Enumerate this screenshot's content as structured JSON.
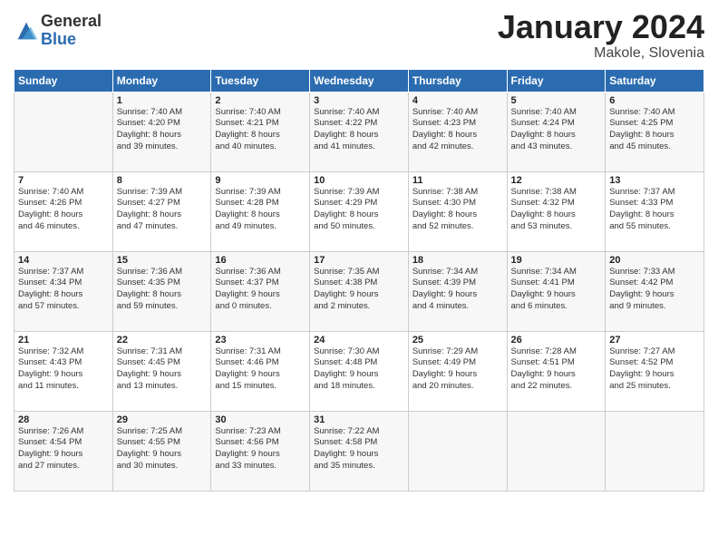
{
  "header": {
    "logo_general": "General",
    "logo_blue": "Blue",
    "month_title": "January 2024",
    "location": "Makole, Slovenia"
  },
  "days_of_week": [
    "Sunday",
    "Monday",
    "Tuesday",
    "Wednesday",
    "Thursday",
    "Friday",
    "Saturday"
  ],
  "weeks": [
    [
      {
        "day": "",
        "lines": []
      },
      {
        "day": "1",
        "lines": [
          "Sunrise: 7:40 AM",
          "Sunset: 4:20 PM",
          "Daylight: 8 hours",
          "and 39 minutes."
        ]
      },
      {
        "day": "2",
        "lines": [
          "Sunrise: 7:40 AM",
          "Sunset: 4:21 PM",
          "Daylight: 8 hours",
          "and 40 minutes."
        ]
      },
      {
        "day": "3",
        "lines": [
          "Sunrise: 7:40 AM",
          "Sunset: 4:22 PM",
          "Daylight: 8 hours",
          "and 41 minutes."
        ]
      },
      {
        "day": "4",
        "lines": [
          "Sunrise: 7:40 AM",
          "Sunset: 4:23 PM",
          "Daylight: 8 hours",
          "and 42 minutes."
        ]
      },
      {
        "day": "5",
        "lines": [
          "Sunrise: 7:40 AM",
          "Sunset: 4:24 PM",
          "Daylight: 8 hours",
          "and 43 minutes."
        ]
      },
      {
        "day": "6",
        "lines": [
          "Sunrise: 7:40 AM",
          "Sunset: 4:25 PM",
          "Daylight: 8 hours",
          "and 45 minutes."
        ]
      }
    ],
    [
      {
        "day": "7",
        "lines": [
          "Sunrise: 7:40 AM",
          "Sunset: 4:26 PM",
          "Daylight: 8 hours",
          "and 46 minutes."
        ]
      },
      {
        "day": "8",
        "lines": [
          "Sunrise: 7:39 AM",
          "Sunset: 4:27 PM",
          "Daylight: 8 hours",
          "and 47 minutes."
        ]
      },
      {
        "day": "9",
        "lines": [
          "Sunrise: 7:39 AM",
          "Sunset: 4:28 PM",
          "Daylight: 8 hours",
          "and 49 minutes."
        ]
      },
      {
        "day": "10",
        "lines": [
          "Sunrise: 7:39 AM",
          "Sunset: 4:29 PM",
          "Daylight: 8 hours",
          "and 50 minutes."
        ]
      },
      {
        "day": "11",
        "lines": [
          "Sunrise: 7:38 AM",
          "Sunset: 4:30 PM",
          "Daylight: 8 hours",
          "and 52 minutes."
        ]
      },
      {
        "day": "12",
        "lines": [
          "Sunrise: 7:38 AM",
          "Sunset: 4:32 PM",
          "Daylight: 8 hours",
          "and 53 minutes."
        ]
      },
      {
        "day": "13",
        "lines": [
          "Sunrise: 7:37 AM",
          "Sunset: 4:33 PM",
          "Daylight: 8 hours",
          "and 55 minutes."
        ]
      }
    ],
    [
      {
        "day": "14",
        "lines": [
          "Sunrise: 7:37 AM",
          "Sunset: 4:34 PM",
          "Daylight: 8 hours",
          "and 57 minutes."
        ]
      },
      {
        "day": "15",
        "lines": [
          "Sunrise: 7:36 AM",
          "Sunset: 4:35 PM",
          "Daylight: 8 hours",
          "and 59 minutes."
        ]
      },
      {
        "day": "16",
        "lines": [
          "Sunrise: 7:36 AM",
          "Sunset: 4:37 PM",
          "Daylight: 9 hours",
          "and 0 minutes."
        ]
      },
      {
        "day": "17",
        "lines": [
          "Sunrise: 7:35 AM",
          "Sunset: 4:38 PM",
          "Daylight: 9 hours",
          "and 2 minutes."
        ]
      },
      {
        "day": "18",
        "lines": [
          "Sunrise: 7:34 AM",
          "Sunset: 4:39 PM",
          "Daylight: 9 hours",
          "and 4 minutes."
        ]
      },
      {
        "day": "19",
        "lines": [
          "Sunrise: 7:34 AM",
          "Sunset: 4:41 PM",
          "Daylight: 9 hours",
          "and 6 minutes."
        ]
      },
      {
        "day": "20",
        "lines": [
          "Sunrise: 7:33 AM",
          "Sunset: 4:42 PM",
          "Daylight: 9 hours",
          "and 9 minutes."
        ]
      }
    ],
    [
      {
        "day": "21",
        "lines": [
          "Sunrise: 7:32 AM",
          "Sunset: 4:43 PM",
          "Daylight: 9 hours",
          "and 11 minutes."
        ]
      },
      {
        "day": "22",
        "lines": [
          "Sunrise: 7:31 AM",
          "Sunset: 4:45 PM",
          "Daylight: 9 hours",
          "and 13 minutes."
        ]
      },
      {
        "day": "23",
        "lines": [
          "Sunrise: 7:31 AM",
          "Sunset: 4:46 PM",
          "Daylight: 9 hours",
          "and 15 minutes."
        ]
      },
      {
        "day": "24",
        "lines": [
          "Sunrise: 7:30 AM",
          "Sunset: 4:48 PM",
          "Daylight: 9 hours",
          "and 18 minutes."
        ]
      },
      {
        "day": "25",
        "lines": [
          "Sunrise: 7:29 AM",
          "Sunset: 4:49 PM",
          "Daylight: 9 hours",
          "and 20 minutes."
        ]
      },
      {
        "day": "26",
        "lines": [
          "Sunrise: 7:28 AM",
          "Sunset: 4:51 PM",
          "Daylight: 9 hours",
          "and 22 minutes."
        ]
      },
      {
        "day": "27",
        "lines": [
          "Sunrise: 7:27 AM",
          "Sunset: 4:52 PM",
          "Daylight: 9 hours",
          "and 25 minutes."
        ]
      }
    ],
    [
      {
        "day": "28",
        "lines": [
          "Sunrise: 7:26 AM",
          "Sunset: 4:54 PM",
          "Daylight: 9 hours",
          "and 27 minutes."
        ]
      },
      {
        "day": "29",
        "lines": [
          "Sunrise: 7:25 AM",
          "Sunset: 4:55 PM",
          "Daylight: 9 hours",
          "and 30 minutes."
        ]
      },
      {
        "day": "30",
        "lines": [
          "Sunrise: 7:23 AM",
          "Sunset: 4:56 PM",
          "Daylight: 9 hours",
          "and 33 minutes."
        ]
      },
      {
        "day": "31",
        "lines": [
          "Sunrise: 7:22 AM",
          "Sunset: 4:58 PM",
          "Daylight: 9 hours",
          "and 35 minutes."
        ]
      },
      {
        "day": "",
        "lines": []
      },
      {
        "day": "",
        "lines": []
      },
      {
        "day": "",
        "lines": []
      }
    ]
  ]
}
